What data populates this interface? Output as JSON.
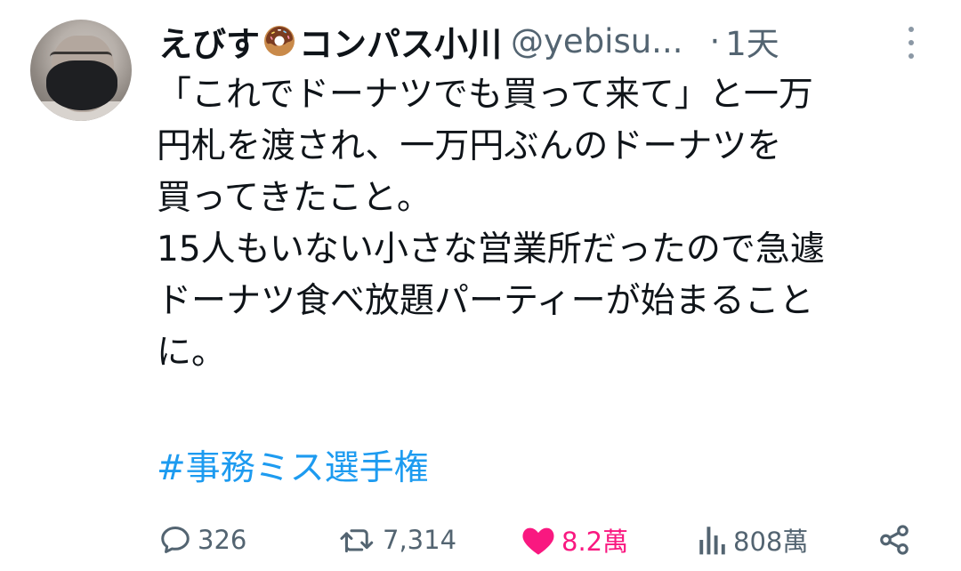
{
  "author": {
    "name_prefix": "えびす",
    "name_emoji": "donut-emoji",
    "name_suffix": "コンパス小川",
    "handle": "@yebisu...",
    "separator": "·",
    "time": "1天"
  },
  "tweet": {
    "lines": [
      "「これでドーナツでも買って来て」と一万",
      "円札を渡され、一万円ぶんのドーナツを",
      "買ってきたこと。",
      "15人もいない小さな営業所だったので急遽",
      "ドーナツ食べ放題パーティーが始まること",
      "に。"
    ],
    "hashtag": "#事務ミス選手権"
  },
  "actions": {
    "reply_count": "326",
    "retweet_count": "7,314",
    "like_count": "8.2萬",
    "view_count": "808萬"
  },
  "colors": {
    "text": "#0f1419",
    "secondary": "#536471",
    "link": "#1d9bf0",
    "like": "#f91880"
  }
}
